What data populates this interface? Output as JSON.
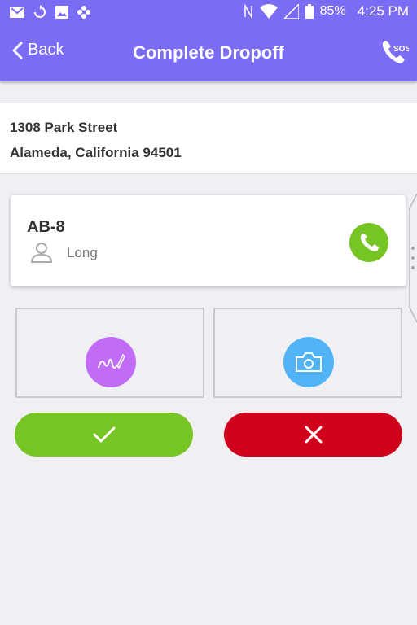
{
  "status_bar": {
    "battery": "85%",
    "time": "4:25 PM",
    "left_icons": [
      "gmail-icon",
      "sync-icon",
      "image-icon",
      "flower-icon"
    ],
    "right_icons": [
      "nfc-icon",
      "wifi-icon",
      "signal-icon",
      "battery-icon"
    ]
  },
  "header": {
    "back_label": "Back",
    "title": "Complete Dropoff",
    "sos_label": "SOS"
  },
  "address": {
    "line1": "1308 Park Street",
    "line2": "Alameda, California 94501"
  },
  "contact_card": {
    "code": "AB-8",
    "name": "Long"
  },
  "actions": {
    "signature_icon": "signature-icon",
    "camera_icon": "camera-icon"
  },
  "colors": {
    "primary": "#7b6cf6",
    "call_green": "#77c425",
    "confirm_green": "#77c425",
    "cancel_red": "#d0021b",
    "signature_purple": "#c06cf6",
    "camera_blue": "#4fb3f6"
  }
}
